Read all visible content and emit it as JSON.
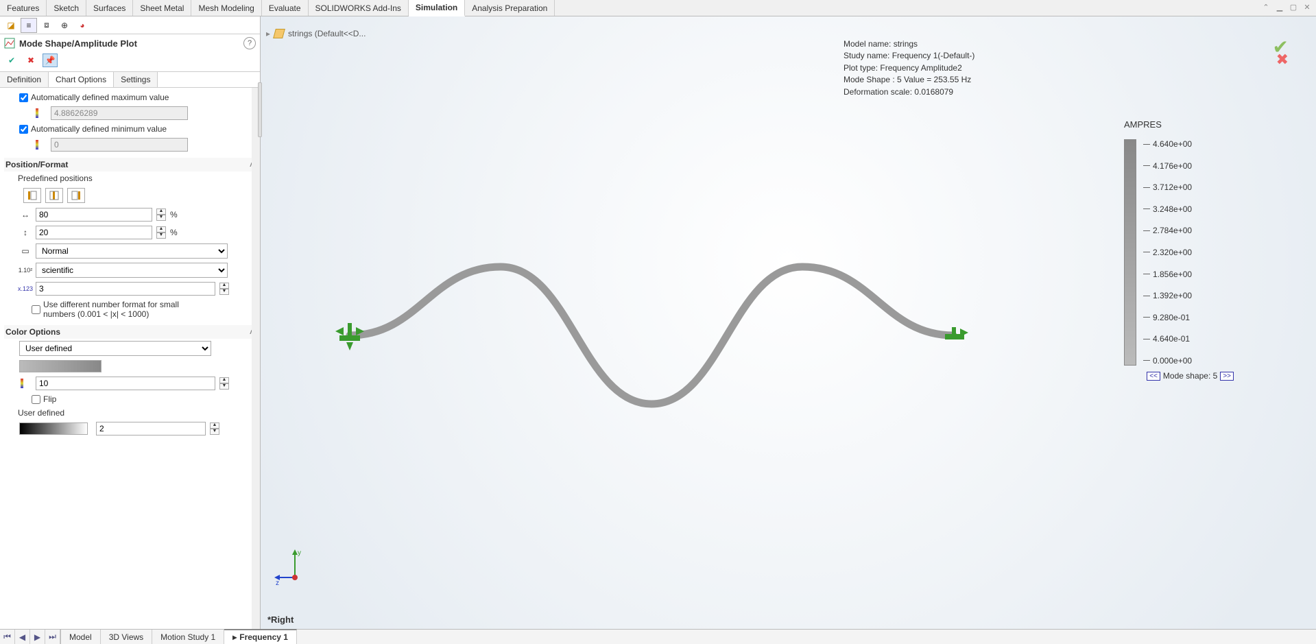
{
  "ribbon": {
    "tabs": [
      "Features",
      "Sketch",
      "Surfaces",
      "Sheet Metal",
      "Mesh Modeling",
      "Evaluate",
      "SOLIDWORKS Add-Ins",
      "Simulation",
      "Analysis Preparation"
    ],
    "active": "Simulation"
  },
  "breadcrumb": {
    "label": "strings  (Default<<D..."
  },
  "panel": {
    "title": "Mode Shape/Amplitude Plot",
    "sub_tabs": [
      "Definition",
      "Chart Options",
      "Settings"
    ],
    "sub_active": "Chart Options",
    "auto_max_label": "Automatically defined maximum value",
    "auto_max_value": "4.88626289",
    "auto_min_label": "Automatically defined minimum value",
    "auto_min_value": "0",
    "position_format_head": "Position/Format",
    "predef_label": "Predefined positions",
    "h_pos": "80",
    "v_pos": "20",
    "pct": "%",
    "width_mode": "Normal",
    "num_format": "scientific",
    "decimals": "3",
    "diff_num_label": "Use different number format for small numbers (0.001 < |x| < 1000)",
    "color_head": "Color Options",
    "color_mode": "User defined",
    "levels": "10",
    "flip_label": "Flip",
    "user_def_label": "User defined",
    "user_def_val": "2"
  },
  "model_info": {
    "l1": "Model name: strings",
    "l2": "Study name: Frequency 1(-Default-)",
    "l3": "Plot type: Frequency Amplitude2",
    "l4": "Mode Shape : 5  Value =        253.55 Hz",
    "l5": "Deformation scale: 0.0168079"
  },
  "legend": {
    "title": "AMPRES",
    "ticks": [
      "4.640e+00",
      "4.176e+00",
      "3.712e+00",
      "3.248e+00",
      "2.784e+00",
      "2.320e+00",
      "1.856e+00",
      "1.392e+00",
      "9.280e-01",
      "4.640e-01",
      "0.000e+00"
    ],
    "mode_label": "Mode shape: 5",
    "prev": "<<",
    "next": ">>"
  },
  "view_label": "*Right",
  "bottom_tabs": {
    "tabs": [
      "Model",
      "3D Views",
      "Motion Study 1",
      "Frequency 1"
    ],
    "active": "Frequency 1"
  }
}
